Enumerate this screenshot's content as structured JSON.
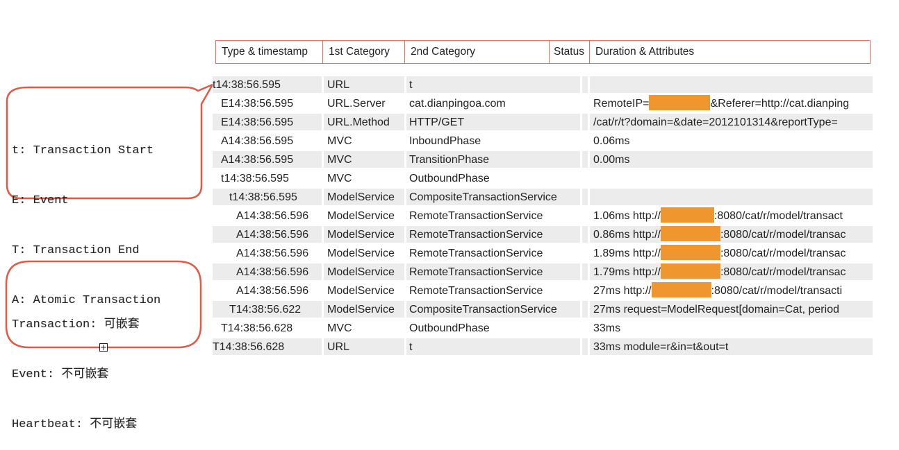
{
  "header": {
    "columns": [
      "Type & timestamp",
      "1st Category",
      "2nd Category",
      "Status",
      "Duration & Attributes"
    ]
  },
  "legend_types": {
    "lines": [
      "t: Transaction Start",
      "E: Event",
      "T: Transaction End",
      "A: Atomic Transaction"
    ]
  },
  "legend_nesting": {
    "lines": [
      "Transaction: 可嵌套",
      "Event: 不可嵌套",
      "Heartbeat: 不可嵌套"
    ]
  },
  "redaction_color": "#f0962e",
  "border_color": "#e0705f",
  "rows": [
    {
      "type": "t14:38:56.595",
      "indent": 0,
      "cat1": "URL",
      "cat2": "t",
      "status": "",
      "attr_before": "",
      "redacted": false,
      "attr_after": "",
      "shaded": true
    },
    {
      "type": "E14:38:56.595",
      "indent": 1,
      "cat1": "URL.Server",
      "cat2": "cat.dianpingoa.com",
      "status": "",
      "attr_before": "RemoteIP=",
      "redacted": true,
      "attr_after": "&Referer=http://cat.dianping",
      "shaded": false
    },
    {
      "type": "E14:38:56.595",
      "indent": 1,
      "cat1": "URL.Method",
      "cat2": "HTTP/GET",
      "status": "",
      "attr_before": "/cat/r/t?domain=&date=2012101314&reportType=",
      "redacted": false,
      "attr_after": "",
      "shaded": true
    },
    {
      "type": "A14:38:56.595",
      "indent": 1,
      "cat1": "MVC",
      "cat2": "InboundPhase",
      "status": "",
      "attr_before": "0.06ms",
      "redacted": false,
      "attr_after": "",
      "shaded": false
    },
    {
      "type": "A14:38:56.595",
      "indent": 1,
      "cat1": "MVC",
      "cat2": "TransitionPhase",
      "status": "",
      "attr_before": "0.00ms",
      "redacted": false,
      "attr_after": "",
      "shaded": true
    },
    {
      "type": "t14:38:56.595",
      "indent": 1,
      "cat1": "MVC",
      "cat2": "OutboundPhase",
      "status": "",
      "attr_before": "",
      "redacted": false,
      "attr_after": "",
      "shaded": false
    },
    {
      "type": "t14:38:56.595",
      "indent": 2,
      "cat1": "ModelService",
      "cat2": "CompositeTransactionService",
      "status": "",
      "attr_before": "",
      "redacted": false,
      "attr_after": "",
      "shaded": true
    },
    {
      "type": "A14:38:56.596",
      "indent": 3,
      "cat1": "ModelService",
      "cat2": "RemoteTransactionService",
      "status": "",
      "attr_before": "1.06ms http://",
      "redacted": true,
      "attr_after": ":8080/cat/r/model/transact",
      "shaded": false
    },
    {
      "type": "A14:38:56.596",
      "indent": 3,
      "cat1": "ModelService",
      "cat2": "RemoteTransactionService",
      "status": "",
      "attr_before": "0.86ms http://",
      "redacted": true,
      "attr_after": ":8080/cat/r/model/transac",
      "shaded": true
    },
    {
      "type": "A14:38:56.596",
      "indent": 3,
      "cat1": "ModelService",
      "cat2": "RemoteTransactionService",
      "status": "",
      "attr_before": "1.89ms http://",
      "redacted": true,
      "attr_after": ":8080/cat/r/model/transac",
      "shaded": false
    },
    {
      "type": "A14:38:56.596",
      "indent": 3,
      "cat1": "ModelService",
      "cat2": "RemoteTransactionService",
      "status": "",
      "attr_before": "1.79ms http://",
      "redacted": true,
      "attr_after": ":8080/cat/r/model/transac",
      "shaded": true
    },
    {
      "type": "A14:38:56.596",
      "indent": 3,
      "cat1": "ModelService",
      "cat2": "RemoteTransactionService",
      "status": "",
      "attr_before": "27ms http://",
      "redacted": true,
      "attr_after": ":8080/cat/r/model/transacti",
      "shaded": false
    },
    {
      "type": "T14:38:56.622",
      "indent": 2,
      "cat1": "ModelService",
      "cat2": "CompositeTransactionService",
      "status": "",
      "attr_before": "27ms request=ModelRequest[domain=Cat, period",
      "redacted": false,
      "attr_after": "",
      "shaded": true
    },
    {
      "type": "T14:38:56.628",
      "indent": 1,
      "cat1": "MVC",
      "cat2": "OutboundPhase",
      "status": "",
      "attr_before": "33ms",
      "redacted": false,
      "attr_after": "",
      "shaded": false
    },
    {
      "type": "T14:38:56.628",
      "indent": 0,
      "cat1": "URL",
      "cat2": "t",
      "status": "",
      "attr_before": "33ms module=r&in=t&out=t",
      "redacted": false,
      "attr_after": "",
      "shaded": true
    }
  ]
}
